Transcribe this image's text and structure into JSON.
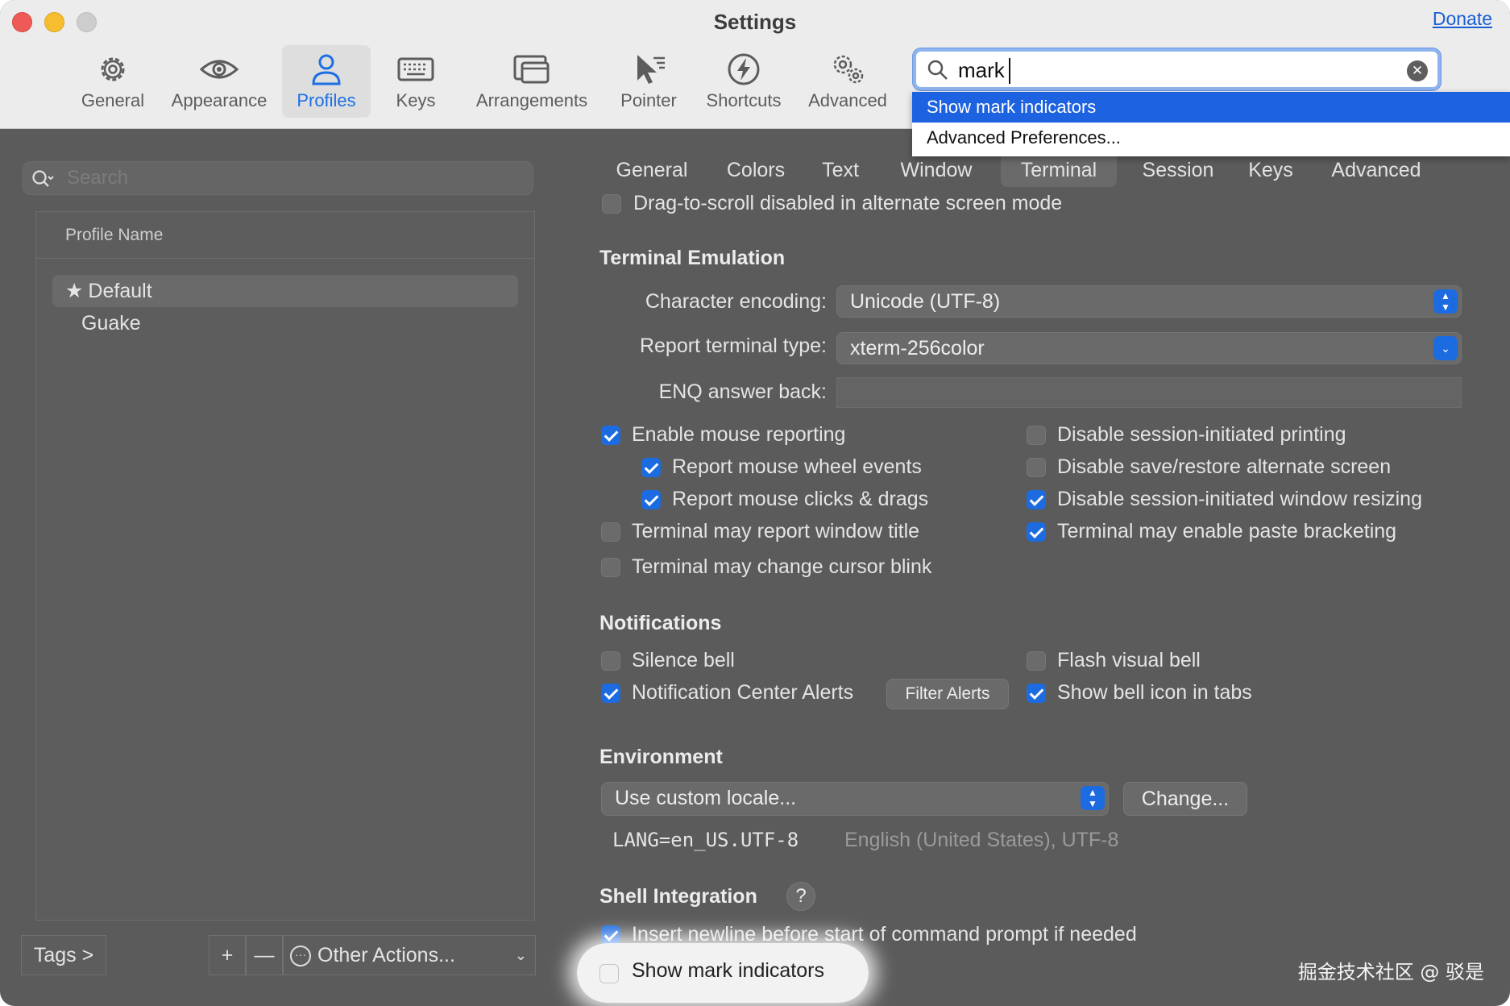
{
  "window": {
    "title": "Settings",
    "donate": "Donate"
  },
  "toolbar": {
    "items": [
      {
        "label": "General",
        "icon": "gear-icon"
      },
      {
        "label": "Appearance",
        "icon": "eye-icon"
      },
      {
        "label": "Profiles",
        "icon": "person-icon",
        "active": true
      },
      {
        "label": "Keys",
        "icon": "keyboard-icon"
      },
      {
        "label": "Arrangements",
        "icon": "windows-icon"
      },
      {
        "label": "Pointer",
        "icon": "pointer-icon"
      },
      {
        "label": "Shortcuts",
        "icon": "lightning-icon"
      },
      {
        "label": "Advanced",
        "icon": "gears-icon"
      }
    ],
    "search_value": "mark"
  },
  "dropdown": {
    "items": [
      "Show mark indicators",
      "Advanced Preferences..."
    ]
  },
  "sidebar": {
    "search_placeholder": "Search",
    "header": "Profile Name",
    "profiles": [
      "Default",
      "Guake"
    ],
    "tags": "Tags >",
    "add": "+",
    "remove": "—",
    "other_actions": "Other Actions..."
  },
  "tabs": [
    "General",
    "Colors",
    "Text",
    "Window",
    "Terminal",
    "Session",
    "Keys",
    "Advanced"
  ],
  "terminal": {
    "drag_scroll": "Drag-to-scroll disabled in alternate screen mode",
    "emulation": {
      "title": "Terminal Emulation",
      "encoding_label": "Character encoding:",
      "encoding_value": "Unicode (UTF-8)",
      "type_label": "Report terminal type:",
      "type_value": "xterm-256color",
      "enq_label": "ENQ answer back:"
    },
    "checks_left": [
      {
        "label": "Enable mouse reporting",
        "checked": true
      },
      {
        "label": "Report mouse wheel events",
        "checked": true
      },
      {
        "label": "Report mouse clicks & drags",
        "checked": true
      },
      {
        "label": "Terminal may report window title",
        "checked": false
      },
      {
        "label": "Terminal may change cursor blink",
        "checked": false
      }
    ],
    "checks_right": [
      {
        "label": "Disable session-initiated printing",
        "checked": false
      },
      {
        "label": "Disable save/restore alternate screen",
        "checked": false
      },
      {
        "label": "Disable session-initiated window resizing",
        "checked": true
      },
      {
        "label": "Terminal may enable paste bracketing",
        "checked": true
      }
    ],
    "notifications": {
      "title": "Notifications",
      "silence_bell": "Silence bell",
      "flash_bell": "Flash visual bell",
      "nc_alerts": "Notification Center Alerts",
      "filter_alerts": "Filter Alerts",
      "bell_icon": "Show bell icon in tabs"
    },
    "environment": {
      "title": "Environment",
      "locale_value": "Use custom locale...",
      "change": "Change...",
      "lang": "LANG=en_US.UTF-8",
      "lang_desc": "English (United States), UTF-8"
    },
    "shell": {
      "title": "Shell Integration",
      "help": "?",
      "newline": "Insert newline before start of command prompt if needed",
      "mark_indicators": "Show mark indicators"
    }
  },
  "watermark": "掘金技术社区 @ 驳是",
  "colors": {
    "accent": "#1c6be0",
    "highlight": "#1d62e0",
    "panel": "#5b5b5b"
  }
}
